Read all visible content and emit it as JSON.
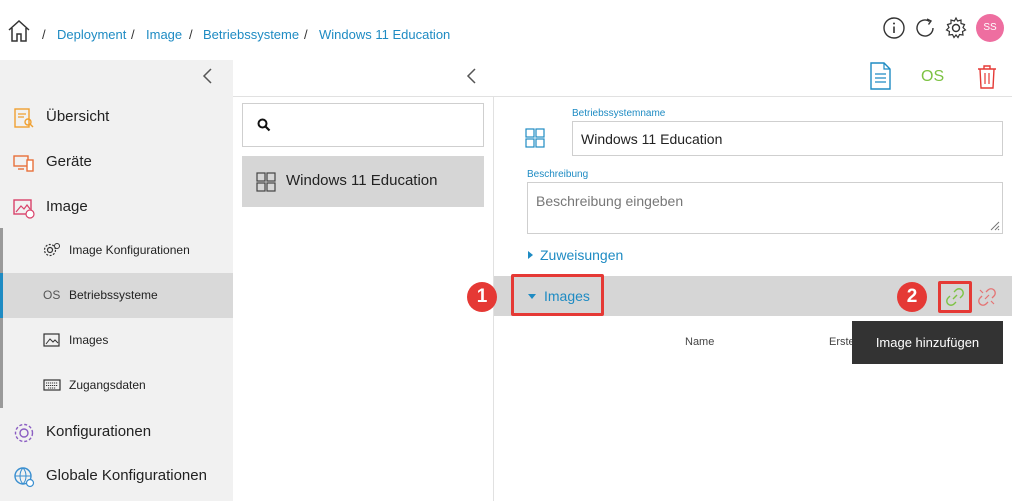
{
  "breadcrumb": {
    "separator": "/",
    "items": [
      "Deployment",
      "Image",
      "Betriebssysteme",
      "Windows 11 Education"
    ]
  },
  "header": {
    "avatar_initials": "SS",
    "icons": [
      "info-icon",
      "refresh-icon",
      "gear-icon"
    ]
  },
  "sidebar": {
    "items": [
      {
        "label": "Übersicht",
        "icon": "overview-icon"
      },
      {
        "label": "Geräte",
        "icon": "devices-icon"
      },
      {
        "label": "Image",
        "icon": "image-icon"
      }
    ],
    "subitems": [
      {
        "label": "Image Konfigurationen",
        "icon": "gear-icon"
      },
      {
        "label": "Betriebssysteme",
        "icon": "os-text-icon",
        "icon_text": "OS",
        "active": true
      },
      {
        "label": "Images",
        "icon": "picture-icon"
      },
      {
        "label": "Zugangsdaten",
        "icon": "keyboard-icon"
      }
    ],
    "bottom_items": [
      {
        "label": "Konfigurationen",
        "icon": "configurations-icon"
      },
      {
        "label": "Globale Konfigurationen",
        "icon": "global-config-icon"
      }
    ]
  },
  "toolbar": {
    "os_label": "OS",
    "colors": {
      "doc": "#1e8bc3",
      "os": "#7cc242",
      "trash": "#e53935"
    }
  },
  "list": {
    "search_placeholder": "",
    "items": [
      {
        "label": "Windows 11 Education",
        "selected": true
      }
    ]
  },
  "detail": {
    "name_label": "Betriebssystemname",
    "name_value": "Windows 11 Education",
    "desc_label": "Beschreibung",
    "desc_placeholder": "Beschreibung eingeben",
    "zuweisungen_label": "Zuweisungen",
    "images_label": "Images",
    "columns": [
      "Name",
      "Erstelldat"
    ],
    "tooltip": "Image hinzufügen"
  },
  "annotations": {
    "step1": "1",
    "step2": "2",
    "highlight_color": "#e53935"
  },
  "colors": {
    "accent": "#1e8bc3",
    "active_bg": "#d9d9d9",
    "sidebar_bg": "#f1f1f1",
    "link_green": "#7cc242"
  }
}
